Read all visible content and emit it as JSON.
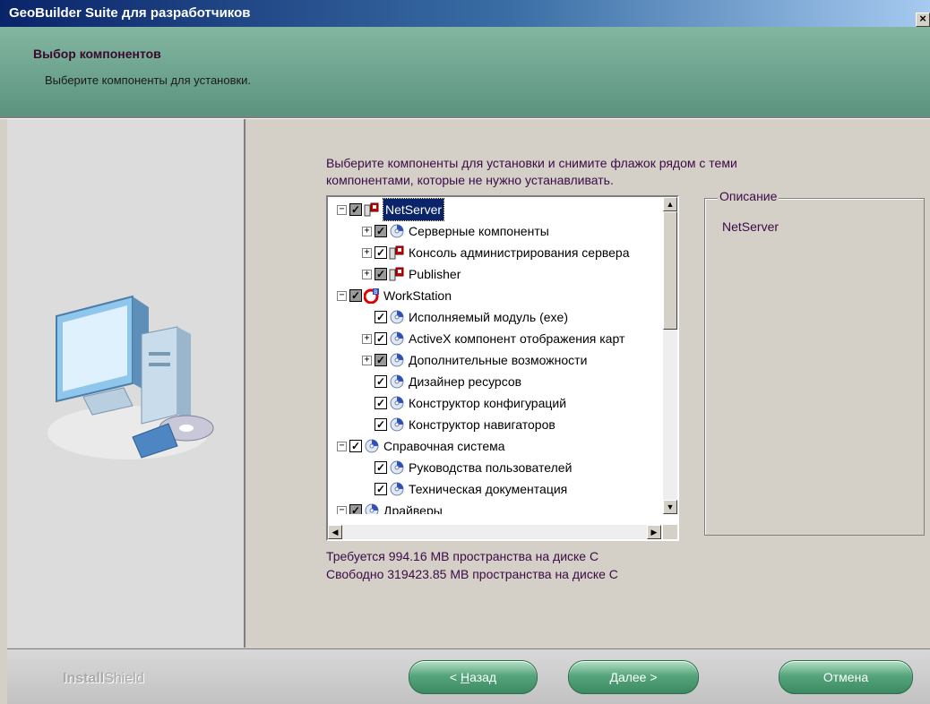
{
  "window": {
    "title": "GeoBuilder Suite для разработчиков",
    "close_glyph": "×"
  },
  "header": {
    "title": "Выбор компонентов",
    "subtitle": "Выберите компоненты для установки."
  },
  "content": {
    "intro_line1": "Выберите компоненты для установки и снимите флажок рядом с теми",
    "intro_line2": "компонентами, которые не нужно устанавливать.",
    "description_legend": "Описание",
    "description_text": "NetServer",
    "disk_required": "Требуется 994.16 MB пространства на диске C",
    "disk_free": "Свободно 319423.85 MB пространства на диске C"
  },
  "tree": [
    {
      "label": "NetServer",
      "level": 0,
      "expander": "−",
      "checked": true,
      "partial": true,
      "icon": "server-icon",
      "selected": true
    },
    {
      "label": "Серверные компоненты",
      "level": 1,
      "expander": "+",
      "checked": true,
      "partial": true,
      "icon": "disk-icon"
    },
    {
      "label": "Консоль администрирования сервера",
      "level": 1,
      "expander": "+",
      "checked": true,
      "partial": false,
      "icon": "server-icon"
    },
    {
      "label": "Publisher",
      "level": 1,
      "expander": "+",
      "checked": true,
      "partial": true,
      "icon": "server-icon"
    },
    {
      "label": "WorkStation",
      "level": 0,
      "expander": "−",
      "checked": true,
      "partial": true,
      "icon": "workstation-icon"
    },
    {
      "label": "Исполняемый модуль (exe)",
      "level": 1,
      "expander": "",
      "checked": true,
      "partial": false,
      "icon": "disk-icon"
    },
    {
      "label": "ActiveX компонент отображения карт",
      "level": 1,
      "expander": "+",
      "checked": true,
      "partial": false,
      "icon": "disk-icon"
    },
    {
      "label": "Дополнительные возможности",
      "level": 1,
      "expander": "+",
      "checked": true,
      "partial": true,
      "icon": "disk-icon"
    },
    {
      "label": "Дизайнер ресурсов",
      "level": 1,
      "expander": "",
      "checked": true,
      "partial": false,
      "icon": "disk-icon"
    },
    {
      "label": "Конструктор конфигураций",
      "level": 1,
      "expander": "",
      "checked": true,
      "partial": false,
      "icon": "disk-icon"
    },
    {
      "label": "Конструктор навигаторов",
      "level": 1,
      "expander": "",
      "checked": true,
      "partial": false,
      "icon": "disk-icon"
    },
    {
      "label": "Справочная система",
      "level": 0,
      "expander": "−",
      "checked": true,
      "partial": false,
      "icon": "disk-icon"
    },
    {
      "label": "Руководства пользователей",
      "level": 1,
      "expander": "",
      "checked": true,
      "partial": false,
      "icon": "disk-icon"
    },
    {
      "label": "Техническая документация",
      "level": 1,
      "expander": "",
      "checked": true,
      "partial": false,
      "icon": "disk-icon"
    },
    {
      "label": "Драйверы",
      "level": 0,
      "expander": "−",
      "checked": true,
      "partial": true,
      "icon": "disk-icon"
    }
  ],
  "footer": {
    "brand_a": "Install",
    "brand_b": "Shield",
    "back_prefix": "< ",
    "back_hotkey": "Н",
    "back_rest": "азад",
    "next_hotkey": "Д",
    "next_rest": "алее >",
    "cancel_label": "Отмена"
  },
  "colors": {
    "accent": "#0a246a",
    "header_bg": "#6fa58f",
    "text_purple": "#3c0a46",
    "button_green": "#4f9c74"
  }
}
